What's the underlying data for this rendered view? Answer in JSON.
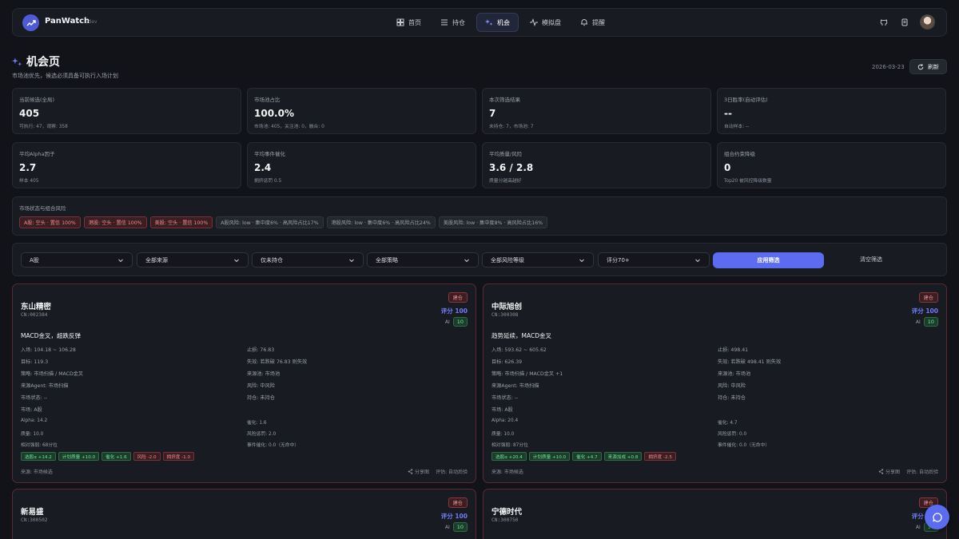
{
  "app": {
    "brand": "PanWatch",
    "version": "vdev"
  },
  "nav": [
    {
      "label": "首页",
      "icon": "dashboard-icon"
    },
    {
      "label": "持仓",
      "icon": "list-icon"
    },
    {
      "label": "机会",
      "icon": "sparkles-icon",
      "active": true
    },
    {
      "label": "模拟盘",
      "icon": "activity-icon"
    },
    {
      "label": "提醒",
      "icon": "bell-icon"
    }
  ],
  "header": {
    "title": "机会页",
    "subtitle": "市场池优先，候选必须具备可执行入场计划",
    "date": "2026-03-23",
    "refresh_label": "刷新"
  },
  "stats": [
    {
      "label": "当前候选(全局)",
      "value": "405",
      "sub": "可执行: 47，观察: 358"
    },
    {
      "label": "市场池占比",
      "value": "100.0%",
      "sub": "市场池: 405，关注池: 0，融合: 0"
    },
    {
      "label": "本次筛选结果",
      "value": "7",
      "sub": "未持仓: 7，市场池: 7"
    },
    {
      "label": "3日胜率(自动评估)",
      "value": "--",
      "sub": "自动样本: --"
    },
    {
      "label": "平均Alpha因子",
      "value": "2.7",
      "sub": "样本 405"
    },
    {
      "label": "平均事件催化",
      "value": "2.4",
      "sub": "拥挤惩罚 0.5"
    },
    {
      "label": "平均质量/风险",
      "value": "3.6 / 2.8",
      "sub": "质量分越高越好"
    },
    {
      "label": "组合约束降级",
      "value": "0",
      "sub": "Top20 被风控降级数量"
    }
  ],
  "risk": {
    "title": "市场状态与组合风险",
    "tags": [
      {
        "text": "A股: 空头 · 置信 100%",
        "tone": "red"
      },
      {
        "text": "港股: 空头 · 置信 100%",
        "tone": "red"
      },
      {
        "text": "美股: 空头 · 置信 100%",
        "tone": "red"
      },
      {
        "text": "A股风险: low · 集中度6% · 高风险占比17%",
        "tone": "gray"
      },
      {
        "text": "港股风险: low · 集中度6% · 高风险占比24%",
        "tone": "gray"
      },
      {
        "text": "美股风险: low · 集中度8% · 高风险占比16%",
        "tone": "gray"
      }
    ]
  },
  "filters": {
    "selects": [
      "A股",
      "全部来源",
      "仅未持仓",
      "全部策略",
      "全部风险等级",
      "评分70+"
    ],
    "apply_label": "应用筛选",
    "clear_label": "清空筛选"
  },
  "cards": [
    {
      "name": "东山精密",
      "code": "CN:002384",
      "badge": "建仓",
      "score": "评分 100",
      "ai_label": "AI",
      "ai_value": "10",
      "headline": "MACD金叉，超跌反弹",
      "left": [
        "入场: 104.18 ~ 106.28",
        "目标: 119.3",
        "策略: 市场扫描 / MACD金叉",
        "来源Agent: 市场扫描",
        "市场状态: --",
        "市场: A股"
      ],
      "right": [
        "止损: 76.83",
        "失效: 若跌破 76.83 则失效",
        "来源池: 市场池",
        "风险: 中风险",
        "持仓: 未持仓"
      ],
      "metrics_l": [
        "Alpha: 14.2",
        "质量: 10.0",
        "相对强弱: 68分位"
      ],
      "metrics_r": [
        "催化: 1.6",
        "风险惩罚: 2.0",
        "事件催化: 0.0（无命中）"
      ],
      "chips": [
        {
          "text": "选股α +14.2",
          "tone": "g"
        },
        {
          "text": "计划质量 +10.0",
          "tone": "g"
        },
        {
          "text": "催化 +1.6",
          "tone": "g"
        },
        {
          "text": "风险 -2.0",
          "tone": "r"
        },
        {
          "text": "拥挤度 -1.0",
          "tone": "r"
        }
      ],
      "source": "来源: 市场候选",
      "share": "分享图",
      "eval": "评估: 自动后验"
    },
    {
      "name": "中际旭创",
      "code": "CN:300308",
      "badge": "建仓",
      "score": "评分 100",
      "ai_label": "AI",
      "ai_value": "10",
      "headline": "趋势延续，MACD金叉",
      "left": [
        "入场: 593.62 ~ 605.62",
        "目标: 626.39",
        "策略: 市场扫描 / MACD金叉 +1",
        "来源Agent: 市场扫描",
        "市场状态: --",
        "市场: A股"
      ],
      "right": [
        "止损: 498.41",
        "失效: 若跌破 498.41 则失效",
        "来源池: 市场池",
        "风险: 中风险",
        "持仓: 未持仓"
      ],
      "metrics_l": [
        "Alpha: 20.4",
        "质量: 10.0",
        "相对强弱: 87分位"
      ],
      "metrics_r": [
        "催化: 4.7",
        "风险惩罚: 0.0",
        "事件催化: 0.0（无命中）"
      ],
      "chips": [
        {
          "text": "选股α +20.4",
          "tone": "g"
        },
        {
          "text": "计划质量 +10.0",
          "tone": "g"
        },
        {
          "text": "催化 +4.7",
          "tone": "g"
        },
        {
          "text": "来源加成 +0.8",
          "tone": "g"
        },
        {
          "text": "拥挤度 -2.5",
          "tone": "r"
        }
      ],
      "source": "来源: 市场候选",
      "share": "分享图",
      "eval": "评估: 自动后验"
    },
    {
      "name": "新易盛",
      "code": "CN:300502",
      "badge": "建仓",
      "score": "评分 100",
      "ai_label": "AI",
      "ai_value": "10"
    },
    {
      "name": "宁德时代",
      "code": "CN:300750",
      "badge": "建仓",
      "score": "评分 100",
      "ai_label": "AI",
      "ai_value": "10"
    }
  ],
  "colors": {
    "accent": "#5b6cf0",
    "danger": "#f08a8f",
    "success": "#6fe39a",
    "bg": "#111318"
  }
}
